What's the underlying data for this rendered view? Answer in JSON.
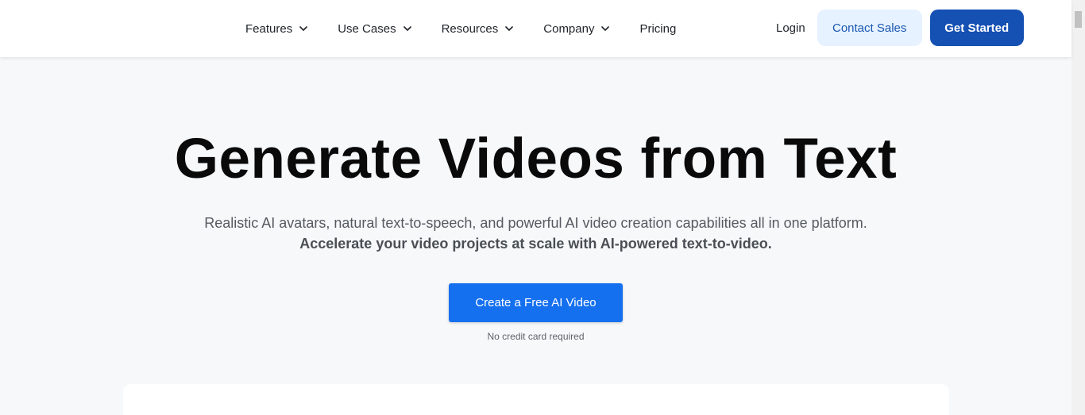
{
  "nav": {
    "items": [
      {
        "label": "Features",
        "has_dropdown": true
      },
      {
        "label": "Use Cases",
        "has_dropdown": true
      },
      {
        "label": "Resources",
        "has_dropdown": true
      },
      {
        "label": "Company",
        "has_dropdown": true
      },
      {
        "label": "Pricing",
        "has_dropdown": false
      }
    ],
    "login_label": "Login",
    "contact_label": "Contact Sales",
    "get_started_label": "Get Started"
  },
  "hero": {
    "title": "Generate Videos from Text",
    "subtitle_line1": "Realistic AI avatars, natural text-to-speech, and powerful AI video creation capabilities all in one platform.",
    "subtitle_line2": "Accelerate your video projects at scale with AI-powered text-to-video.",
    "cta_label": "Create a Free AI Video",
    "cta_note": "No credit card required"
  },
  "icons": {
    "dropdown": "chevron-down-icon"
  },
  "colors": {
    "primary": "#1550b3",
    "cta": "#1570ef",
    "contact_bg": "#e6f2ff",
    "page_bg": "#f7f8fa"
  }
}
